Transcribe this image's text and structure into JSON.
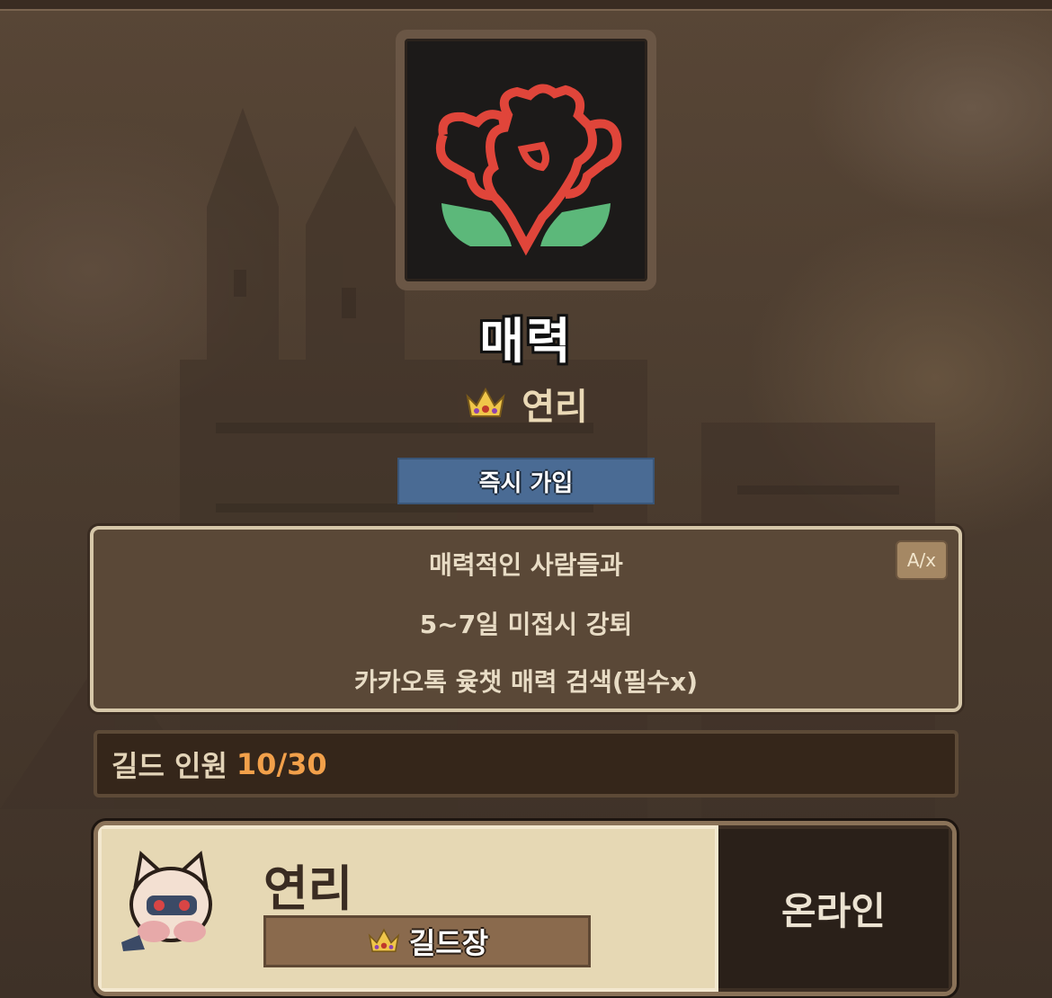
{
  "guild": {
    "name": "매력",
    "leader_name": "연리",
    "join_button_label": "즉시 가입",
    "description_lines": [
      "매력적인 사람들과",
      "5~7일 미접시 강퇴",
      "카카오톡 윷챗 매력 검색(필수x)"
    ],
    "translate_button_label": "A/x",
    "member_count_label": "길드 인원",
    "member_count_value": "10/30",
    "emblem_icon": "flower-emblem-icon"
  },
  "member": {
    "name": "연리",
    "role": "길드장",
    "status": "온라인",
    "avatar_icon": "cat-avatar-icon"
  },
  "colors": {
    "join_button": "#4a6b94",
    "member_count_value": "#f2a04a",
    "emblem_petal": "#e0453a",
    "emblem_leaf": "#5cb87a"
  }
}
